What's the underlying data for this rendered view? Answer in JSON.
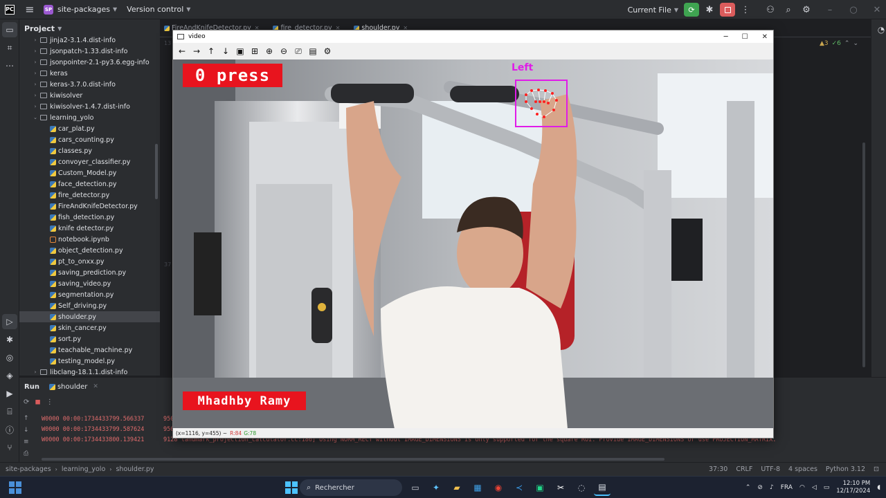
{
  "titlebar": {
    "app_badge": "SP",
    "project_name": "site-packages",
    "vcs_menu": "Version control",
    "run_config": "Current File"
  },
  "project_panel": {
    "title": "Project",
    "items": [
      {
        "label": "jinja2-3.1.4.dist-info",
        "type": "folder",
        "indent": 1
      },
      {
        "label": "jsonpatch-1.33.dist-info",
        "type": "folder",
        "indent": 1
      },
      {
        "label": "jsonpointer-2.1-py3.6.egg-info",
        "type": "folder",
        "indent": 1
      },
      {
        "label": "keras",
        "type": "folder",
        "indent": 1
      },
      {
        "label": "keras-3.7.0.dist-info",
        "type": "folder",
        "indent": 1
      },
      {
        "label": "kiwisolver",
        "type": "folder",
        "indent": 1
      },
      {
        "label": "kiwisolver-1.4.7.dist-info",
        "type": "folder",
        "indent": 1
      },
      {
        "label": "learning_yolo",
        "type": "folder-open",
        "indent": 1
      },
      {
        "label": "car_plat.py",
        "type": "py",
        "indent": 2
      },
      {
        "label": "cars_counting.py",
        "type": "py",
        "indent": 2
      },
      {
        "label": "classes.py",
        "type": "py",
        "indent": 2
      },
      {
        "label": "convoyer_classifier.py",
        "type": "py",
        "indent": 2
      },
      {
        "label": "Custom_Model.py",
        "type": "py",
        "indent": 2
      },
      {
        "label": "face_detection.py",
        "type": "py",
        "indent": 2
      },
      {
        "label": "fire_detector.py",
        "type": "py",
        "indent": 2
      },
      {
        "label": "FireAndKnifeDetector.py",
        "type": "py",
        "indent": 2
      },
      {
        "label": "fish_detection.py",
        "type": "py",
        "indent": 2
      },
      {
        "label": "knife detector.py",
        "type": "py",
        "indent": 2
      },
      {
        "label": "notebook.ipynb",
        "type": "nb",
        "indent": 2
      },
      {
        "label": "object_detection.py",
        "type": "py",
        "indent": 2
      },
      {
        "label": "pt_to_onxx.py",
        "type": "py",
        "indent": 2
      },
      {
        "label": "saving_prediction.py",
        "type": "py",
        "indent": 2
      },
      {
        "label": "saving_video.py",
        "type": "py",
        "indent": 2
      },
      {
        "label": "segmentation.py",
        "type": "py",
        "indent": 2
      },
      {
        "label": "Self_driving.py",
        "type": "py",
        "indent": 2
      },
      {
        "label": "shoulder.py",
        "type": "py",
        "indent": 2,
        "selected": true
      },
      {
        "label": "skin_cancer.py",
        "type": "py",
        "indent": 2
      },
      {
        "label": "sort.py",
        "type": "py",
        "indent": 2
      },
      {
        "label": "teachable_machine.py",
        "type": "py",
        "indent": 2
      },
      {
        "label": "testing_model.py",
        "type": "py",
        "indent": 2
      },
      {
        "label": "libclang-18.1.1.dist-info",
        "type": "folder",
        "indent": 1
      }
    ]
  },
  "editor": {
    "tabs": [
      "FireAndKnifeDetector.py",
      "fire_detector.py",
      "shoulder.py"
    ],
    "line_numbers": [
      "13",
      "",
      "",
      "",
      "",
      "",
      "",
      "",
      "",
      "",
      "",
      "",
      "",
      "",
      "",
      "",
      "",
      "",
      "",
      "",
      "37"
    ],
    "warnings": "▲3",
    "checks": "✓6"
  },
  "video_window": {
    "title": "video",
    "status_coords": "(x=1116, y=455) ~",
    "status_r": "R:84",
    "status_g": "G:78",
    "overlay_press": "0 press",
    "overlay_name": "Mhadhby Ramy",
    "overlay_hand": "Left"
  },
  "run_panel": {
    "title": "Run",
    "tab": "shoulder",
    "console_lines": [
      {
        "left": "W0000 00:00:1734433799.566337",
        "right": "950"
      },
      {
        "left": "W0000 00:00:1734433799.587624",
        "right": "950"
      },
      {
        "left": "W0000 00:00:1734433800.139421",
        "right": "9128 landmark_projection_calculator.cc:186] Using NORM_RECT without IMAGE_DIMENSIONS is only supported for the square ROI. Provide IMAGE_DIMENSIONS or use PROJECTION_MATRIX."
      }
    ]
  },
  "statusbar": {
    "crumbs": [
      "site-packages",
      "learning_yolo",
      "shoulder.py"
    ],
    "position": "37:30",
    "line_sep": "CRLF",
    "encoding": "UTF-8",
    "indent": "4 spaces",
    "interpreter": "Python 3.12"
  },
  "taskbar": {
    "search_placeholder": "Rechercher",
    "lang": "FRA",
    "time": "12:10 PM",
    "date": "12/17/2024"
  },
  "colors": {
    "overlay_red": "#e8141e",
    "hand_magenta": "#e01be8",
    "ide_bg": "#1e1f22",
    "panel_bg": "#2b2d30"
  }
}
